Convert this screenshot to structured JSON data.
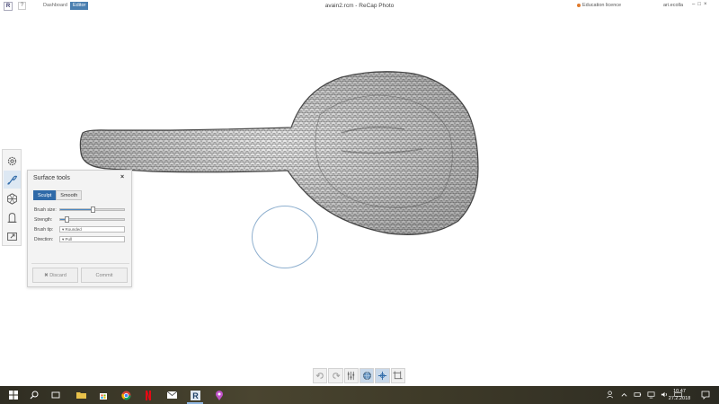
{
  "titlebar": {
    "logo": "R",
    "help": "?",
    "tabs": {
      "dashboard": "Dashboard",
      "editor": "Editor"
    },
    "document_title": "avain2.rcm - ReCap Photo",
    "license": "Education licence",
    "user": "ari.ecolla"
  },
  "left_toolbar": {
    "items": [
      "settings-icon",
      "brush-icon",
      "mesh-icon",
      "measure-icon",
      "export-icon"
    ],
    "active": "brush-icon"
  },
  "surface_tools": {
    "title": "Surface tools",
    "close": "×",
    "modes": {
      "sculpt": "Sculpt",
      "smooth": "Smooth"
    },
    "active_mode": "Sculpt",
    "brush_size_label": "Brush size:",
    "brush_size_value": 0.5,
    "strength_label": "Strength:",
    "strength_value": 0.1,
    "brush_tip_label": "Brush tip:",
    "brush_tip_value": "Rounded",
    "direction_label": "Direction:",
    "direction_value": "Pull",
    "discard_label": "Discard",
    "commit_label": "Commit"
  },
  "bottom_toolbar": {
    "items": [
      "undo-icon",
      "redo-icon",
      "adjust-icon",
      "sphere-view-icon",
      "move-icon",
      "frame-icon"
    ],
    "active": [
      "sphere-view-icon",
      "move-icon"
    ]
  },
  "taskbar": {
    "time": "10.47",
    "date": "27.2.2018",
    "apps": [
      "windows-start-icon",
      "search-icon",
      "task-view-icon",
      "file-explorer-icon",
      "store-icon",
      "chrome-icon",
      "netflix-icon",
      "mail-icon",
      "recap-icon",
      "maps-pin-icon"
    ],
    "active_app": "recap-icon"
  },
  "colors": {
    "accent": "#2f6aa8",
    "editor_tab": "#4a7fb0",
    "brush_ring": "#8fb0cf",
    "taskbar": "#3c3a2c"
  }
}
